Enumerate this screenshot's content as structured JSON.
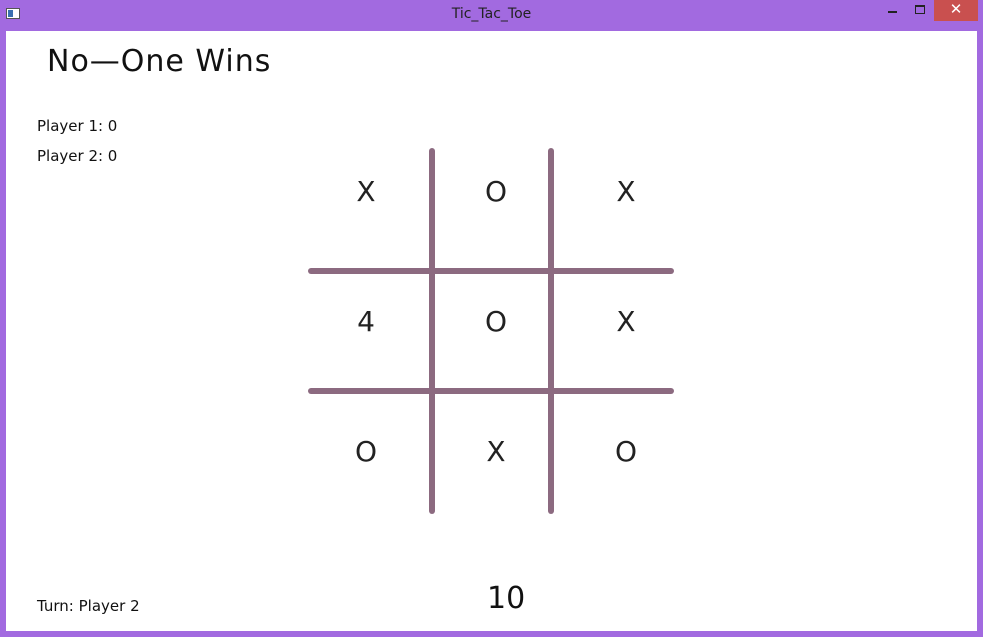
{
  "window": {
    "title": "Tic_Tac_Toe",
    "minimize_glyph": "",
    "maximize_glyph": "",
    "close_glyph": "✕"
  },
  "status": {
    "headline": "No—One Wins",
    "player1_score": "Player 1: 0",
    "player2_score": "Player 2: 0",
    "turn": "Turn: Player 2",
    "timer": "10"
  },
  "board": {
    "cells": [
      "X",
      "O",
      "X",
      "4",
      "O",
      "X",
      "O",
      "X",
      "O"
    ]
  },
  "colors": {
    "frame": "#a26ae0",
    "grid_line": "#8c6a80",
    "close_button": "#c9504f"
  }
}
